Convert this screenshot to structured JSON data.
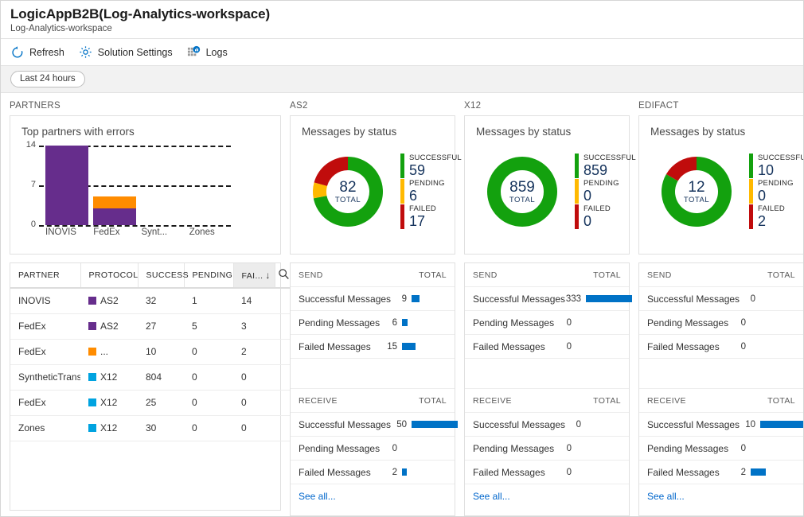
{
  "header": {
    "title": "LogicAppB2B(Log-Analytics-workspace)",
    "subtitle": "Log-Analytics-workspace"
  },
  "toolbar": {
    "items": [
      {
        "label": "Refresh",
        "icon": "refresh-icon"
      },
      {
        "label": "Solution Settings",
        "icon": "gear-icon"
      },
      {
        "label": "Logs",
        "icon": "logs-icon"
      }
    ]
  },
  "time_range": {
    "label": "Last 24 hours"
  },
  "colors": {
    "purple": "#662D8C",
    "orange": "#FF8C00",
    "cyan": "#00A3E0",
    "green": "#13A10E",
    "amber": "#FFB900",
    "red": "#C00C0C",
    "blue_bar": "#0072C6",
    "link": "#0066CC"
  },
  "partners": {
    "column_title": "PARTNERS",
    "chart_data": {
      "type": "bar",
      "title": "Top partners with errors",
      "categories": [
        "INOVIS",
        "FedEx",
        "Synt...",
        "Zones"
      ],
      "series": [
        {
          "name": "AS2",
          "color": "#662D8C",
          "values": [
            14,
            3,
            0,
            0
          ]
        },
        {
          "name": "EDIFACT",
          "color": "#FF8C00",
          "values": [
            0,
            2,
            0,
            0
          ]
        }
      ],
      "stacked": true,
      "ylabel": "",
      "xlabel": "",
      "ylim": [
        0,
        14
      ],
      "yticks": [
        0,
        7,
        14
      ],
      "ytick_labels": [
        "0",
        "7",
        "14"
      ],
      "grid": true
    },
    "table": {
      "columns": [
        "PARTNER",
        "PROTOCOL",
        "SUCCESS",
        "PENDING",
        "FAI..."
      ],
      "sorted_column": "FAI...",
      "sort_direction": "desc",
      "search_icon": "search-icon",
      "rows": [
        {
          "partner": "INOVIS",
          "protocol": "AS2",
          "swatch": "#662D8C",
          "success": "32",
          "pending": "1",
          "failed": "14"
        },
        {
          "partner": "FedEx",
          "protocol": "AS2",
          "swatch": "#662D8C",
          "success": "27",
          "pending": "5",
          "failed": "3"
        },
        {
          "partner": "FedEx",
          "protocol": "...",
          "swatch": "#FF8C00",
          "success": "10",
          "pending": "0",
          "failed": "2"
        },
        {
          "partner": "SyntheticTrans",
          "protocol": "X12",
          "swatch": "#00A3E0",
          "success": "804",
          "pending": "0",
          "failed": "0"
        },
        {
          "partner": "FedEx",
          "protocol": "X12",
          "swatch": "#00A3E0",
          "success": "25",
          "pending": "0",
          "failed": "0"
        },
        {
          "partner": "Zones",
          "protocol": "X12",
          "swatch": "#00A3E0",
          "success": "30",
          "pending": "0",
          "failed": "0"
        }
      ]
    }
  },
  "protocols": [
    {
      "column_title": "AS2",
      "chart_data": {
        "type": "pie",
        "title": "Messages by status",
        "labels": [
          "SUCCESSFUL",
          "PENDING",
          "FAILED"
        ],
        "values": [
          59,
          6,
          17
        ],
        "colors": [
          "#13A10E",
          "#FFB900",
          "#C00C0C"
        ],
        "total": "82",
        "total_label": "TOTAL",
        "legend": "right"
      },
      "send": {
        "header_left": "SEND",
        "header_right": "TOTAL",
        "rows": [
          {
            "name": "Successful Messages",
            "value": "9",
            "bar_pct": 18
          },
          {
            "name": "Pending Messages",
            "value": "6",
            "bar_pct": 12
          },
          {
            "name": "Failed Messages",
            "value": "15",
            "bar_pct": 30
          }
        ]
      },
      "receive": {
        "header_left": "RECEIVE",
        "header_right": "TOTAL",
        "rows": [
          {
            "name": "Successful Messages",
            "value": "50",
            "bar_pct": 100
          },
          {
            "name": "Pending Messages",
            "value": "0",
            "bar_pct": 0
          },
          {
            "name": "Failed Messages",
            "value": "2",
            "bar_pct": 8
          }
        ]
      },
      "see_all": "See all..."
    },
    {
      "column_title": "X12",
      "chart_data": {
        "type": "pie",
        "title": "Messages by status",
        "labels": [
          "SUCCESSFUL",
          "PENDING",
          "FAILED"
        ],
        "values": [
          859,
          0,
          0
        ],
        "colors": [
          "#13A10E",
          "#FFB900",
          "#C00C0C"
        ],
        "total": "859",
        "total_label": "TOTAL",
        "legend": "right"
      },
      "send": {
        "header_left": "SEND",
        "header_right": "TOTAL",
        "rows": [
          {
            "name": "Successful Messages",
            "value": "333",
            "bar_pct": 100
          },
          {
            "name": "Pending Messages",
            "value": "0",
            "bar_pct": 0
          },
          {
            "name": "Failed Messages",
            "value": "0",
            "bar_pct": 0
          }
        ]
      },
      "receive": {
        "header_left": "RECEIVE",
        "header_right": "TOTAL",
        "rows": [
          {
            "name": "Successful Messages",
            "value": "0",
            "bar_pct": 0
          },
          {
            "name": "Pending Messages",
            "value": "0",
            "bar_pct": 0
          },
          {
            "name": "Failed Messages",
            "value": "0",
            "bar_pct": 0
          }
        ]
      },
      "see_all": "See all..."
    },
    {
      "column_title": "EDIFACT",
      "chart_data": {
        "type": "pie",
        "title": "Messages by status",
        "labels": [
          "SUCCESSFUL.",
          "PENDING",
          "FAILED"
        ],
        "values": [
          10,
          0,
          2
        ],
        "colors": [
          "#13A10E",
          "#FFB900",
          "#C00C0C"
        ],
        "total": "12",
        "total_label": "TOTAL",
        "legend": "right"
      },
      "send": {
        "header_left": "SEND",
        "header_right": "TOTAL",
        "rows": [
          {
            "name": "Successful Messages",
            "value": "0",
            "bar_pct": 0
          },
          {
            "name": "Pending Messages",
            "value": "0",
            "bar_pct": 0
          },
          {
            "name": "Failed Messages",
            "value": "0",
            "bar_pct": 0
          }
        ]
      },
      "receive": {
        "header_left": "RECEIVE",
        "header_right": "TOTAL",
        "rows": [
          {
            "name": "Successful Messages",
            "value": "10",
            "bar_pct": 100
          },
          {
            "name": "Pending Messages",
            "value": "0",
            "bar_pct": 0
          },
          {
            "name": "Failed Messages",
            "value": "2",
            "bar_pct": 33
          }
        ]
      },
      "see_all": "See all..."
    }
  ]
}
